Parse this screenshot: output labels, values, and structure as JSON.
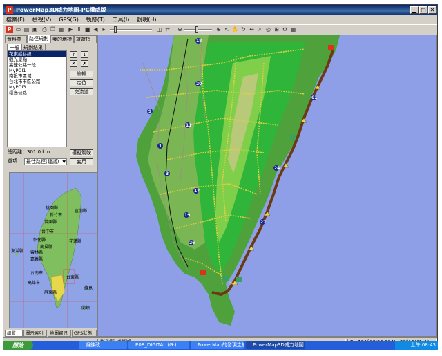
{
  "window": {
    "title": "PowerMap3D威力地圖-PC權威版",
    "app_icon": "P",
    "buttons": [
      "minimize",
      "maximize",
      "close"
    ]
  },
  "menu": [
    "檔案(F)",
    "檢視(V)",
    "GPS(G)",
    "軌跡(T)",
    "工具(I)",
    "說明(H)"
  ],
  "toolbar": {
    "icons": [
      "powermap-icon",
      "new-icon",
      "open-icon",
      "save-icon",
      "print-icon",
      "copy-icon",
      "paste-icon",
      "play-icon",
      "pause-icon",
      "stop-icon",
      "rewind-icon",
      "layers-icon",
      "route-icon",
      "zoom-out-icon",
      "zoom-in-icon",
      "cursor-icon",
      "hand-icon",
      "rotate-icon",
      "ruler-icon",
      "search-icon",
      "gps-icon",
      "measure-icon",
      "settings-icon",
      "grid-icon"
    ]
  },
  "left_tabs": [
    "資料查詢",
    "路徑規劃",
    "我的地標",
    "旅遊指"
  ],
  "sub_tabs": [
    "一般",
    "規劃結果"
  ],
  "route_list": [
    "花東縱谷線",
    "觀光景點",
    "高速公路一段",
    "MyPOI1",
    "南投市區域",
    "台北市市區公路",
    "MyPOI3",
    "環島公路"
  ],
  "route_list_selected": 0,
  "side_buttons": [
    "編輯",
    "定位",
    "交流道"
  ],
  "total_distance_label": "總距離：",
  "total_distance_value": "301.0 km",
  "simulate_button": "模擬駕駛",
  "option_label": "選項",
  "option_value": "最佳路徑(建議)",
  "apply_button": "套用",
  "minimap_labels": [
    "桃園縣",
    "新竹市",
    "苗栗縣",
    "台中市",
    "彰化縣",
    "南投縣",
    "雲林縣",
    "嘉義縣",
    "台南市",
    "高雄市",
    "屏東縣",
    "花蓮縣",
    "台東縣",
    "綠島",
    "蘭嶼",
    "澎湖縣",
    "宜蘭縣"
  ],
  "bottom_tabs": [
    "總覽",
    "圖示索引",
    "地圖資訊",
    "GPS狀態"
  ],
  "status": {
    "location": "彰化縣 埔鹽鄉",
    "coords": "E : 121°09'02.6\"  N : 23°11'41.4\""
  },
  "taskbar": {
    "start": "開始",
    "tasks": [
      "吳鍊政",
      "E08_DIGITAL (G:)",
      "PowerMap的發現之旅 -",
      "PowerMap3D威力地圖"
    ],
    "clock": "上午 08:43"
  },
  "map": {
    "route_labels": [
      "18",
      "20",
      "9",
      "11",
      "1",
      "3",
      "17",
      "19",
      "26",
      "27",
      "24",
      "61"
    ],
    "colors": {
      "sea": "#8e9fe8",
      "lowland": "#4ea13b",
      "mountain": "#2fb53a",
      "highland": "#b9c97a",
      "route": "#6b3a12",
      "road": "#e0d040"
    }
  }
}
